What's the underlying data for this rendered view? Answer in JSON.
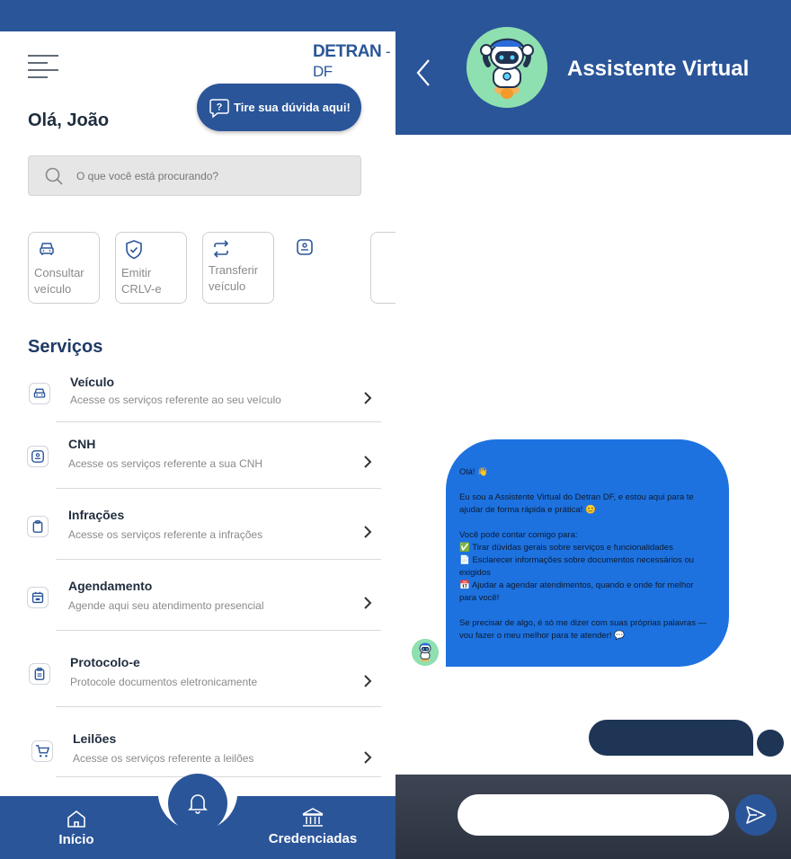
{
  "app": {
    "brand_bold": "DETRAN",
    "brand_suffix": "- DF",
    "greeting": "Olá, João",
    "help_button": "Tire sua dúvida aqui!",
    "search_placeholder": "O que você está procurando?"
  },
  "shortcuts": [
    {
      "label": "Consultar veículo",
      "icon": "car-icon"
    },
    {
      "label": "Emitir CRLV-e",
      "icon": "shield-check-icon"
    },
    {
      "label": "Transferir veículo",
      "icon": "transfer-icon"
    },
    {
      "label": "",
      "icon": "license-icon"
    }
  ],
  "services": {
    "title": "Serviços",
    "items": [
      {
        "title": "Veículo",
        "description": "Acesse os serviços referente ao seu veículo",
        "icon": "car-icon"
      },
      {
        "title": "CNH",
        "description": "Acesse os serviços referente a sua CNH",
        "icon": "license-icon"
      },
      {
        "title": "Infrações",
        "description": "Acesse os serviços referente a infrações",
        "icon": "clipboard-icon"
      },
      {
        "title": "Agendamento",
        "description": "Agende aqui seu atendimento presencial",
        "icon": "calendar-icon"
      },
      {
        "title": "Protocolo-e",
        "description": "Protocole documentos eletronicamente",
        "icon": "document-icon"
      },
      {
        "title": "Leilões",
        "description": "Acesse os serviços referente a leilões",
        "icon": "cart-icon"
      }
    ]
  },
  "bottom_nav": {
    "home": "Início",
    "accredited": "Credenciadas"
  },
  "chat": {
    "title": "Assistente Virtual",
    "message": "Olá! 👋\n\nEu sou a Assistente Virtual do Detran DF, e estou aqui para te ajudar de forma rápida e prática! 😊\n\nVocê pode contar comigo para:\n✅ Tirar dúvidas gerais sobre serviços e funcionalidades\n📄 Esclarecer informações sobre documentos necessários ou exigidos\n📅 Ajudar a agendar atendimentos, quando e onde for melhor para você!\n\nSe precisar de algo, é só me dizer com suas próprias palavras — vou fazer o meu melhor para te atender! 💬"
  },
  "colors": {
    "primary": "#2a5599",
    "bubble": "#1d72e0",
    "user_bubble": "#1e3556",
    "avatar_bg": "#8fe0b0"
  }
}
